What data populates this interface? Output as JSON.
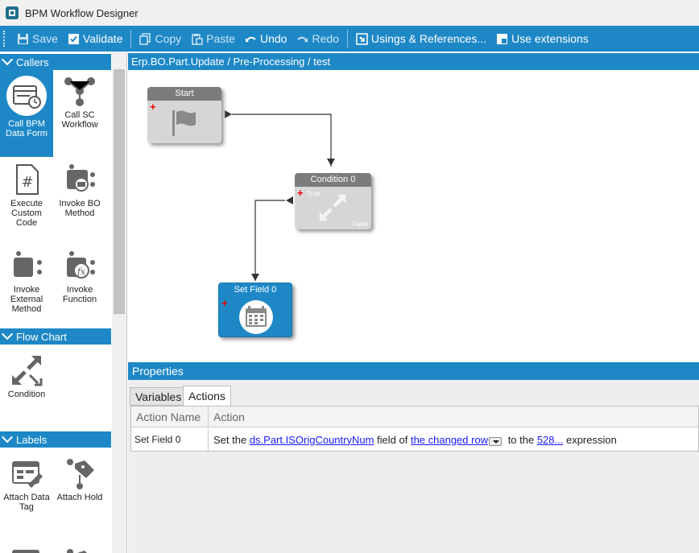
{
  "window": {
    "title": "BPM Workflow Designer"
  },
  "toolbar": {
    "save": "Save",
    "validate": "Validate",
    "copy": "Copy",
    "paste": "Paste",
    "undo": "Undo",
    "redo": "Redo",
    "usings": "Usings & References...",
    "extensions": "Use extensions"
  },
  "sidebar": {
    "callers": {
      "header": "Callers",
      "items": [
        "Call BPM Data Form",
        "Call SC Workflow",
        "Execute Custom Code",
        "Invoke BO Method",
        "Invoke External Method",
        "Invoke Function"
      ]
    },
    "flowchart": {
      "header": "Flow Chart",
      "items": [
        "Condition"
      ]
    },
    "labels": {
      "header": "Labels",
      "items": [
        "Attach Data Tag",
        "Attach Hold"
      ]
    }
  },
  "canvas": {
    "path": "Erp.BO.Part.Update / Pre-Processing / test",
    "nodes": {
      "start": {
        "title": "Start"
      },
      "condition": {
        "title": "Condition 0",
        "true_label": "True",
        "false_label": "False"
      },
      "setfield": {
        "title": "Set Field 0"
      }
    }
  },
  "properties": {
    "header": "Properties",
    "tabs": [
      "Variables",
      "Actions"
    ],
    "active_tab": "Actions",
    "columns": [
      "Action Name",
      "Action"
    ],
    "rows": [
      {
        "name": "Set Field 0",
        "t1": "Set the ",
        "field": "ds.Part.ISOrigCountryNum",
        "t2": " field of ",
        "row": "the changed row",
        "t3": " to the ",
        "expr": "528...",
        "t4": " expression"
      }
    ]
  },
  "colors": {
    "accent": "#1e88c7",
    "node_gray": "#7c7c7c",
    "node_body": "#d6d6d6",
    "link": "#1a1aff",
    "marker": "#e00000"
  }
}
